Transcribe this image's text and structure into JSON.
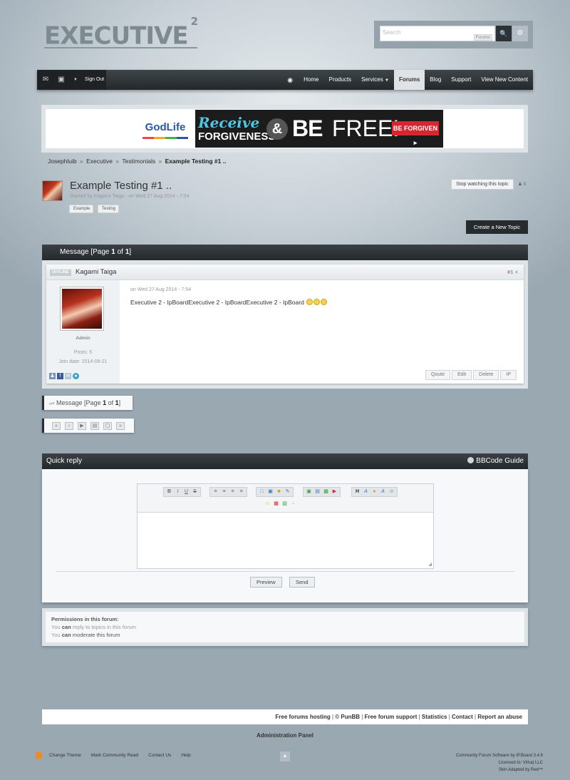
{
  "header": {
    "logo": "EXECUTIVE",
    "logo_sup": "2",
    "search": {
      "placeholder": "Search",
      "scope": "Forums"
    }
  },
  "navbar": {
    "sign_out": "Sign Out",
    "items": [
      "Home",
      "Products",
      "Services",
      "Forums",
      "Blog",
      "Support",
      "View New Content"
    ],
    "active": "Forums"
  },
  "banner": {
    "brand": "GodLife",
    "line1": "Receive",
    "line2": "FORGIVENESS",
    "amp": "&",
    "be": "BE",
    "free": "FREE!",
    "cta": "BE FORGIVEN ▸"
  },
  "breadcrumb": [
    "Josephluib",
    "Executive",
    "Testimonials",
    "Example Testing #1 .."
  ],
  "topic": {
    "title": "Example Testing #1 ..",
    "meta": "Started by Kagami Taiga - on Wed 27 Aug 2014 - 7:54",
    "tags": [
      "Example",
      "Testing"
    ],
    "stop_watching": "Stop watching this topic",
    "followers": "0",
    "create_new": "Create a New Topic"
  },
  "message_panel": {
    "label": "Message [Page ",
    "page": "1",
    "of": " of ",
    "total": "1",
    "end": "]"
  },
  "post": {
    "status": "OFFLINE",
    "author": "Kagami Taiga",
    "number": "#1",
    "rank": "Admin",
    "posts": "Posts: 5",
    "join_date": "Join date: 2014-08-21",
    "date": "on Wed 27 Aug 2014 - 7:54",
    "body": "Executive 2 - IpBoardExecutive 2 - IpBoardExecutive 2 - IpBoard",
    "actions": [
      "Qoute",
      "Edit",
      "Delete",
      "IP"
    ]
  },
  "pagination": {
    "label": "Message [Page ",
    "page": "1",
    "of": " of ",
    "total": "1",
    "end": "]"
  },
  "quick_reply": {
    "title": "Quick reply",
    "guide": "BBCode Guide",
    "preview": "Preview",
    "send": "Send"
  },
  "permissions": {
    "title": "Permissions in this forum:",
    "can": "can",
    "you": "You",
    "reply": "reply to topics in this forum",
    "moderate": "moderate this forum"
  },
  "footer": {
    "links": [
      "Free forums hosting",
      "© PunBB",
      "Free forum support",
      "Statistics",
      "Contact",
      "Report an abuse"
    ],
    "admin_panel": "Administration Panel",
    "bottom_links": [
      "Change Theme",
      "Mark Community Read",
      "Contact Us",
      "Help"
    ],
    "credits": [
      "Community Forum Software by IP.Board 3.4.6",
      "Licensed to: Virtuq LLC",
      "Skin Adapted by Red™"
    ]
  },
  "colors": {
    "accent": "#23282b",
    "navbar": "#2d3236",
    "active_tab": "#dfe3e5",
    "ad_cta": "#d9262c"
  }
}
